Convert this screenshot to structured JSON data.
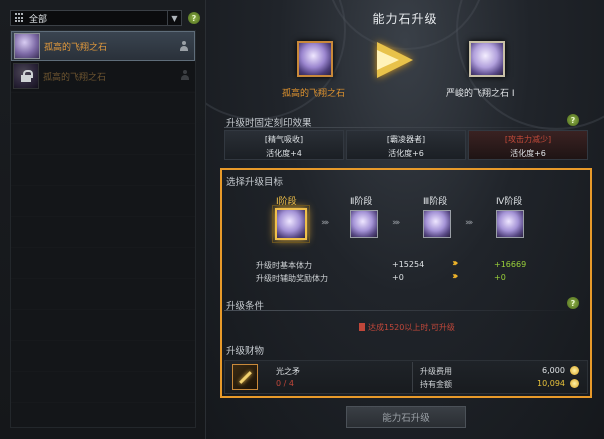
{
  "filter": {
    "label": "全部"
  },
  "list": {
    "items": [
      {
        "name": "孤高的飞翔之石",
        "selected": true,
        "locked": false
      },
      {
        "name": "孤高的飞翔之石",
        "selected": false,
        "locked": true
      }
    ]
  },
  "panel": {
    "title": "能力石升级",
    "from_name": "孤高的飞翔之石",
    "to_name": "严峻的飞翔之石 Ⅰ",
    "effects_title": "升级时固定刻印效果",
    "effects": [
      {
        "name": "[精气吸收]",
        "value": "活化度+4",
        "negative": false
      },
      {
        "name": "[霸凌器者]",
        "value": "活化度+6",
        "negative": false
      },
      {
        "name": "[攻击力减少]",
        "value": "活化度+6",
        "negative": true
      }
    ],
    "target_title": "选择升级目标",
    "stages": [
      {
        "label": "Ⅰ阶段",
        "active": true
      },
      {
        "label": "Ⅱ阶段",
        "active": false
      },
      {
        "label": "Ⅲ阶段",
        "active": false
      },
      {
        "label": "Ⅳ阶段",
        "active": false
      }
    ],
    "stats": [
      {
        "label": "升级时基本体力",
        "current": "+15254",
        "next": "+16669"
      },
      {
        "label": "升级时辅助奖励体力",
        "current": "+0",
        "next": "+0"
      }
    ],
    "condition_title": "升级条件",
    "condition_text": "达成1520以上时,可升级",
    "cost_title": "升级财物",
    "material": {
      "name": "光之矛",
      "count": "0 / 4"
    },
    "cost_label": "升级费用",
    "cost_value": "6,000",
    "owned_label": "持有金额",
    "owned_value": "10,094",
    "button_label": "能力石升级"
  },
  "colors": {
    "accent": "#e89a2a",
    "positive": "#9ad23a",
    "negative": "#c0473a",
    "highlight": "#f0c04a"
  },
  "icons": [
    "grid-icon",
    "chevron-down-icon",
    "help-icon",
    "lock-icon",
    "person-icon",
    "stone-icon",
    "arrow-right-icon",
    "coin-icon",
    "spear-icon"
  ]
}
